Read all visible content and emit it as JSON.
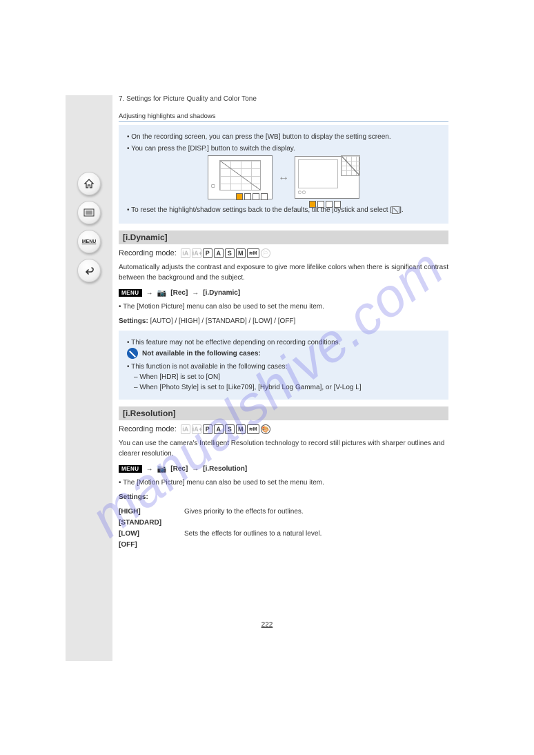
{
  "header": {
    "chapter": "7. Settings for Picture Quality and Color Tone",
    "subsection": "Adjusting highlights and shadows"
  },
  "note1": {
    "line1": "• On the recording screen, you can press the [WB] button to display the setting screen.",
    "line2": "• You can press the [DISP.] button to switch the display.",
    "line3_prefix": "• To reset the highlight/shadow settings back to the defaults, tilt the joystick and select [",
    "line3_suffix": "]."
  },
  "sections": {
    "idyn": {
      "title": "[i.Dynamic]",
      "modes_label": "Recording mode:",
      "desc": "Automatically adjusts the contrast and exposure to give more lifelike colors when there is significant contrast between the background and the subject.",
      "menu_path_rec": "[Rec]",
      "menu_path_item": "[i.Dynamic]",
      "menu_also": "• The [Motion Picture] menu can also be used to set the menu item.",
      "settings_label": "Settings:",
      "settings_values": "[AUTO] / [HIGH] / [STANDARD] / [LOW] / [OFF]",
      "info_bullet": "• This feature may not be effective depending on recording conditions.",
      "not_avail_label": "Not available in the following cases:",
      "not_avail_1": "• This function is not available in the following cases:",
      "not_avail_2": "– When [HDR] is set to [ON]",
      "not_avail_3": "– When [Photo Style] is set to [Like709], [Hybrid Log Gamma], or [V-Log L]"
    },
    "ires": {
      "title": "[i.Resolution]",
      "modes_label": "Recording mode:",
      "desc": "You can use the camera's Intelligent Resolution technology to record still pictures with sharper outlines and clearer resolution.",
      "menu_path_rec": "[Rec]",
      "menu_path_item": "[i.Resolution]",
      "menu_also": "• The [Motion Picture] menu can also be used to set the menu item.",
      "settings_label": "Settings:",
      "settings": [
        {
          "label": "[HIGH]",
          "text": "Gives priority to the effects for outlines."
        },
        {
          "label": "[STANDARD]",
          "text": ""
        },
        {
          "label": "[LOW]",
          "text": "Sets the effects for outlines to a natural level."
        },
        {
          "label": "[OFF]",
          "text": ""
        }
      ]
    }
  },
  "page_number": "222",
  "watermark": "manualshive.com",
  "nav": {
    "home": "home-icon",
    "list": "list-icon",
    "menu": "MENU",
    "back": "back-icon"
  },
  "modes": {
    "set1": [
      "iA",
      "iA+",
      "P",
      "A",
      "S",
      "M",
      "≋M",
      "⚐"
    ],
    "set2": [
      "iA",
      "iA+",
      "P",
      "A",
      "S",
      "M",
      "≋M",
      "🎨"
    ]
  }
}
